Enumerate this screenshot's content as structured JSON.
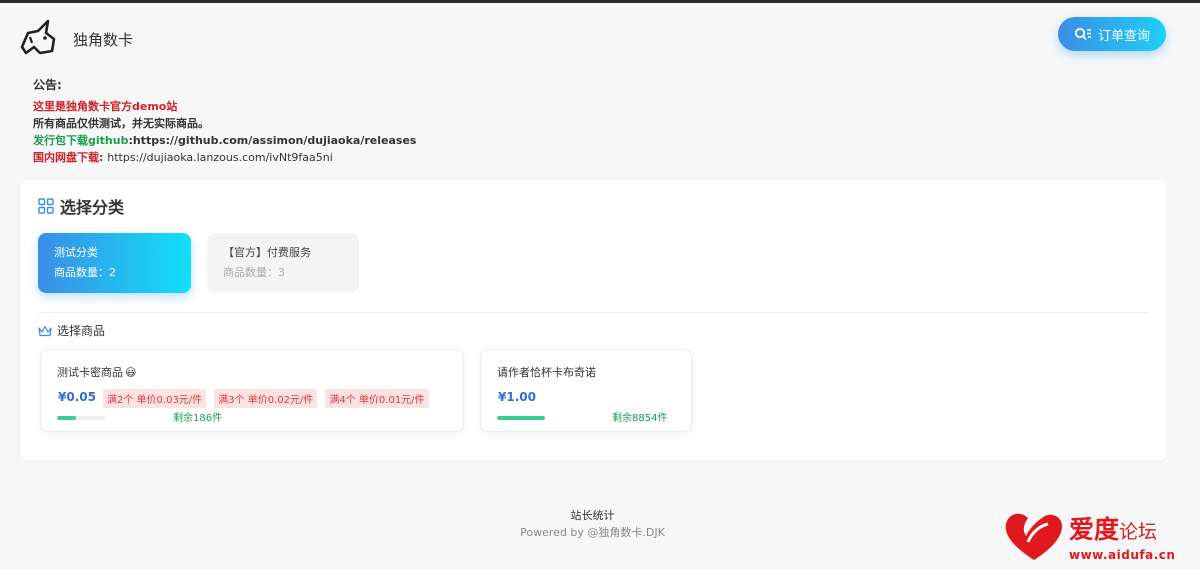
{
  "header": {
    "brand": "独角数卡",
    "order_query_label": "订单查询"
  },
  "notice": {
    "title": "公告:",
    "line1": "这里是独角数卡官方demo站",
    "line2": "所有商品仅供测试，并无实际商品。",
    "line3_label": "发行包下载github",
    "line3_value": ":https://github.com/assimon/dujiaoka/releases",
    "line4_label": "国内网盘下载:",
    "line4_value": "https://dujiaoka.lanzous.com/ivNt9faa5ni"
  },
  "categories": {
    "title": "选择分类",
    "items": [
      {
        "name": "测试分类",
        "count": "商品数量：2"
      },
      {
        "name": "【官方】付费服务",
        "count": "商品数量：3"
      }
    ]
  },
  "goods": {
    "title": "选择商品",
    "items": [
      {
        "name": "测试卡密商品",
        "emoji": "😃",
        "price": "¥0.05",
        "tags": [
          "满2个 单价0.03元/件",
          "满3个 单价0.02元/件",
          "满4个 单价0.01元/件"
        ],
        "stock": "剩余186件",
        "stock_fill": 0.4
      },
      {
        "name": "请作者恰杯卡布奇诺",
        "price": "¥1.00",
        "stock": "剩余8854件",
        "stock_fill": 1.0
      }
    ]
  },
  "footer": {
    "stats": "站长统计",
    "powered": "Powered by @独角数卡.DJK"
  },
  "watermark": {
    "text_main": "爱度",
    "text_sub": "论坛",
    "url": "www.aidufa.cn"
  },
  "colors": {
    "accent_gradient_start": "#3a8ee6",
    "accent_gradient_end": "#12e0f8",
    "notice_red": "#d0212a",
    "notice_green": "#1a9e4c",
    "price_blue": "#2f6fd6",
    "tag_red": "#e0383f",
    "stock_bar": "#3bcc8f"
  }
}
